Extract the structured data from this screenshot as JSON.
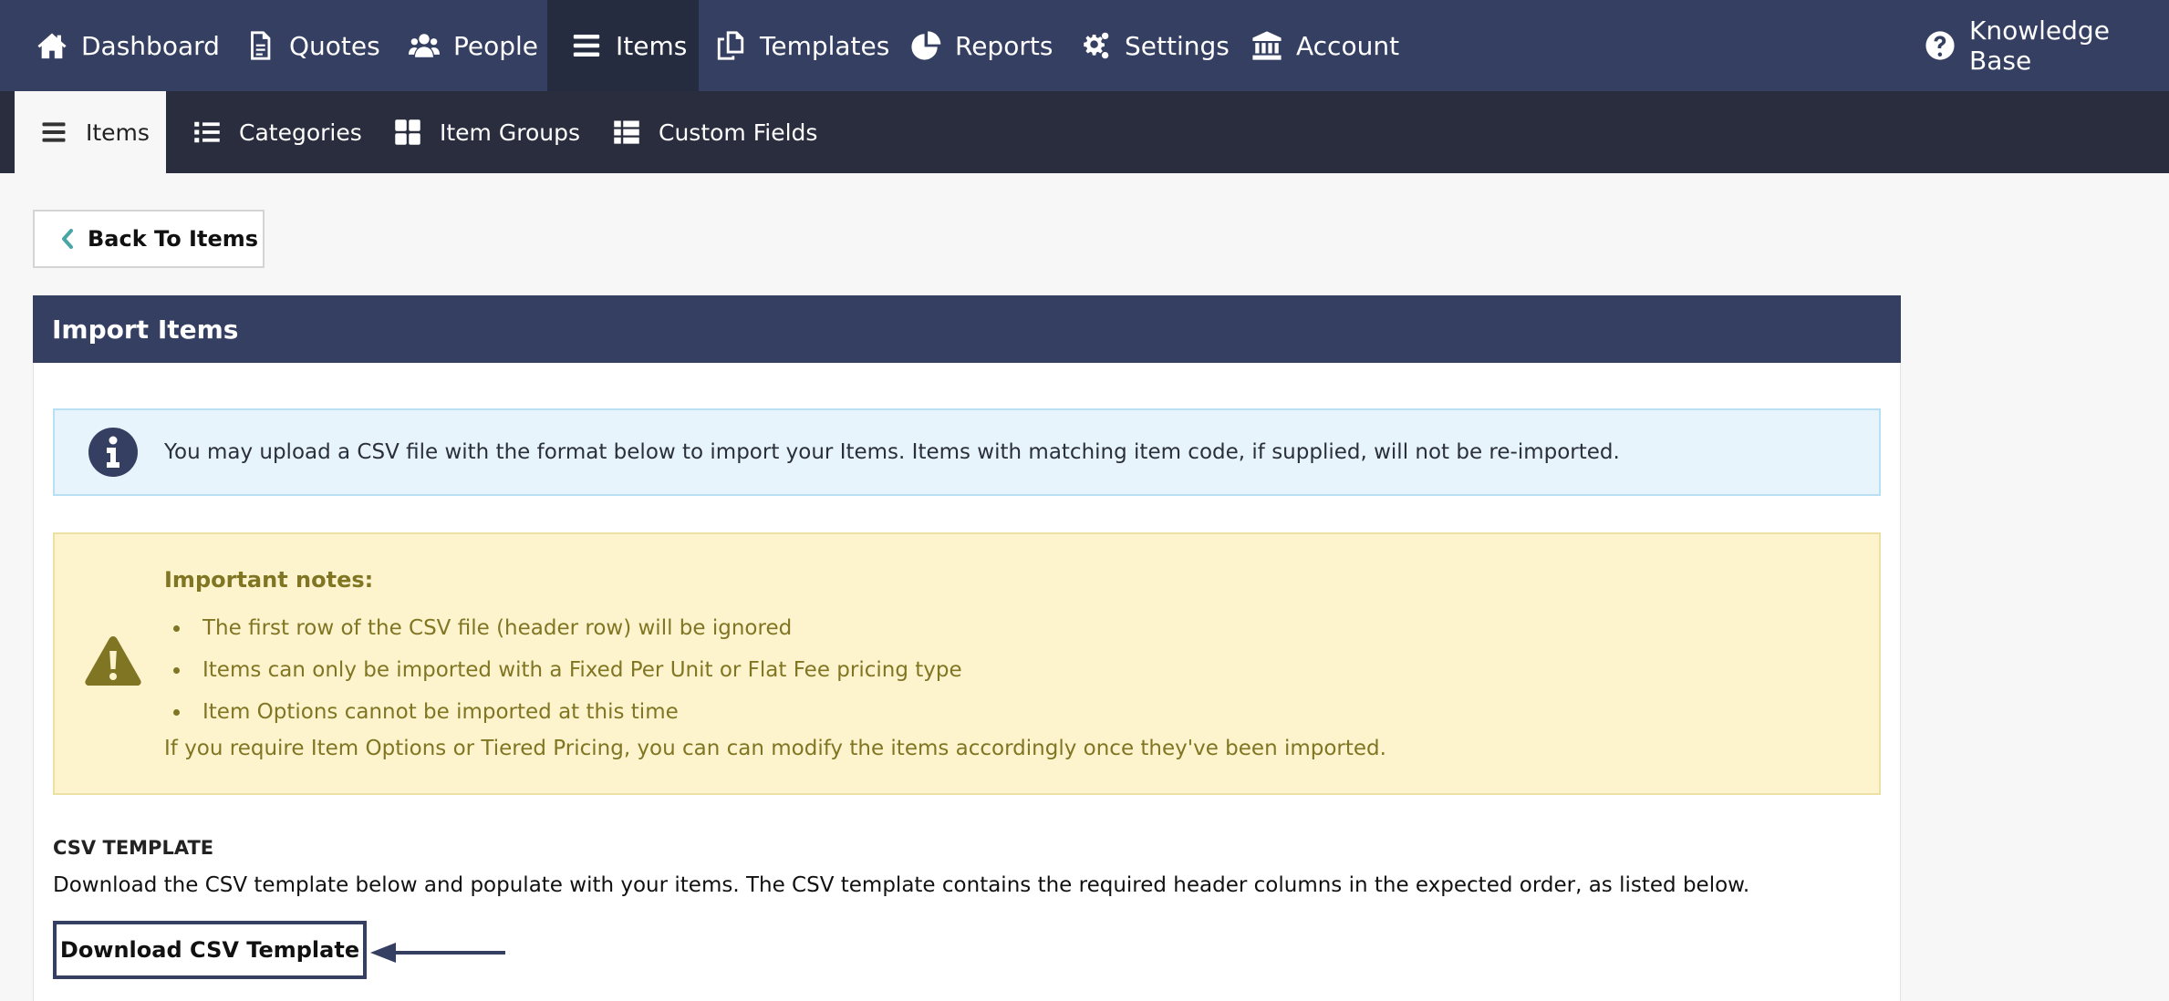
{
  "top_nav": {
    "items": [
      {
        "label": "Dashboard",
        "icon": "home-icon"
      },
      {
        "label": "Quotes",
        "icon": "document-icon"
      },
      {
        "label": "People",
        "icon": "users-icon"
      },
      {
        "label": "Items",
        "icon": "bars-icon",
        "active": true
      },
      {
        "label": "Templates",
        "icon": "copy-icon"
      },
      {
        "label": "Reports",
        "icon": "pie-chart-icon"
      },
      {
        "label": "Settings",
        "icon": "gears-icon"
      },
      {
        "label": "Account",
        "icon": "bank-icon"
      }
    ],
    "help": {
      "label": "Knowledge Base",
      "icon": "question-circle-icon"
    }
  },
  "sub_nav": {
    "items": [
      {
        "label": "Items",
        "icon": "bars-icon",
        "active": true
      },
      {
        "label": "Categories",
        "icon": "list-icon"
      },
      {
        "label": "Item Groups",
        "icon": "grid-icon"
      },
      {
        "label": "Custom Fields",
        "icon": "table-list-icon"
      }
    ]
  },
  "back_button": {
    "label": "Back To Items",
    "icon": "chevron-left-icon"
  },
  "panel": {
    "title": "Import Items",
    "info": {
      "icon": "info-circle-icon",
      "text": "You may upload a CSV file with the format below to import your Items. Items with matching item code, if supplied, will not be re-imported."
    },
    "notes": {
      "icon": "warning-icon",
      "title": "Important notes:",
      "items": [
        "The first row of the CSV file (header row) will be ignored",
        "Items can only be imported with a Fixed Per Unit or Flat Fee pricing type",
        "Item Options cannot be imported at this time"
      ],
      "footer": "If you require Item Options or Tiered Pricing, you can can modify the items accordingly once they've been imported."
    },
    "csv_template": {
      "heading": "CSV TEMPLATE",
      "description": "Download the CSV template below and populate with your items. The CSV template contains the required header columns in the expected order, as listed below.",
      "download_label": "Download CSV Template"
    }
  },
  "colors": {
    "nav_bg": "#353f62",
    "nav_active_bg": "#262c40",
    "subnav_bg": "#2a2d3e",
    "info_bg": "#e7f4fb",
    "warning_bg": "#fdf4cd",
    "warning_text": "#807523",
    "accent_teal": "#4aa6a6"
  }
}
